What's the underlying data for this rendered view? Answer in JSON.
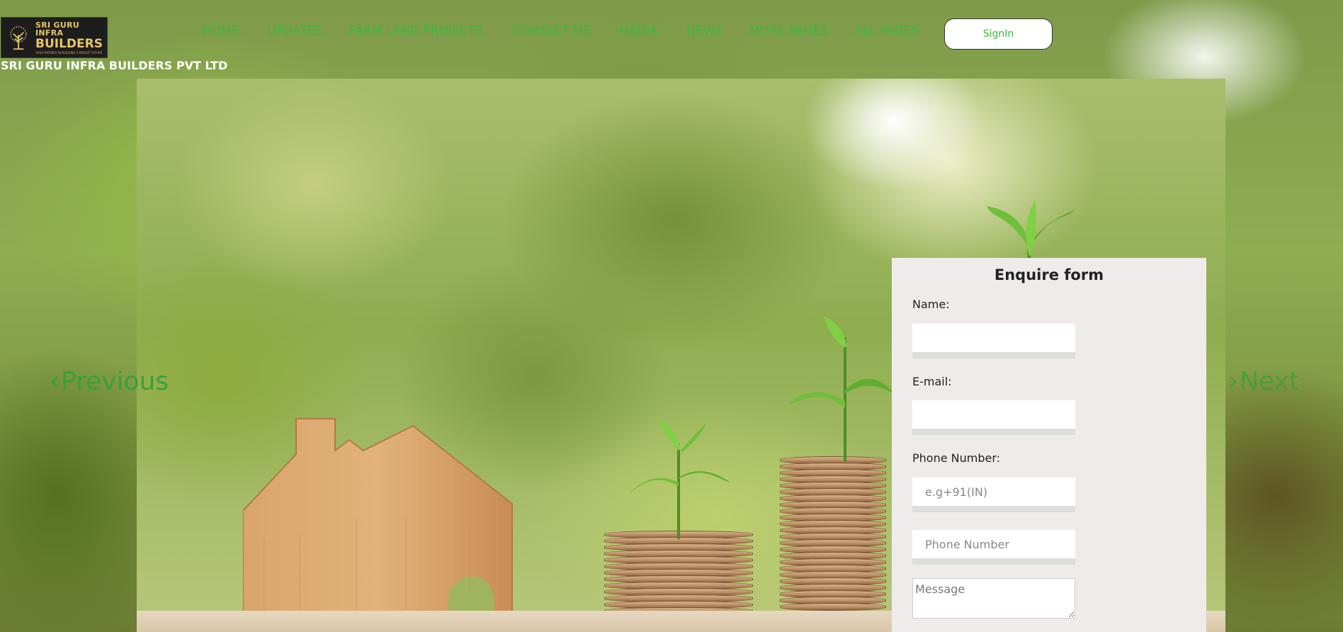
{
  "header": {
    "logo": {
      "top_text": "SRI GURU INFRA",
      "main_text": "BUILDERS",
      "tagline": "YOUR PARTNER IN BUILDING A BRIGHT FUTURE"
    },
    "company_name": "SRI GURU INFRA BUILDERS PVT LTD",
    "nav": [
      {
        "label": "HOME"
      },
      {
        "label": "UPDATES"
      },
      {
        "label": "FARM LAND PROJECTS"
      },
      {
        "label": "CONTACT ME"
      },
      {
        "label": "MEDIA"
      },
      {
        "label": "NEWS"
      },
      {
        "label": "MORE PAGES"
      },
      {
        "label": "ALL PAGES"
      }
    ],
    "signin_label": "SignIn"
  },
  "carousel": {
    "prev_label": "Previous",
    "next_label": "Next"
  },
  "enquire_form": {
    "title": "Enquire form",
    "name_label": "Name:",
    "name_value": "",
    "email_label": "E-mail:",
    "email_value": "",
    "phone_label": "Phone Number:",
    "country_code_placeholder": "e.g+91(IN)",
    "phone_placeholder": "Phone Number",
    "message_placeholder": "Message"
  },
  "colors": {
    "nav_text": "#3fb83a",
    "form_bg": "#efebea",
    "logo_gold": "#e9c56a",
    "logo_bg": "#1d1d1d"
  }
}
